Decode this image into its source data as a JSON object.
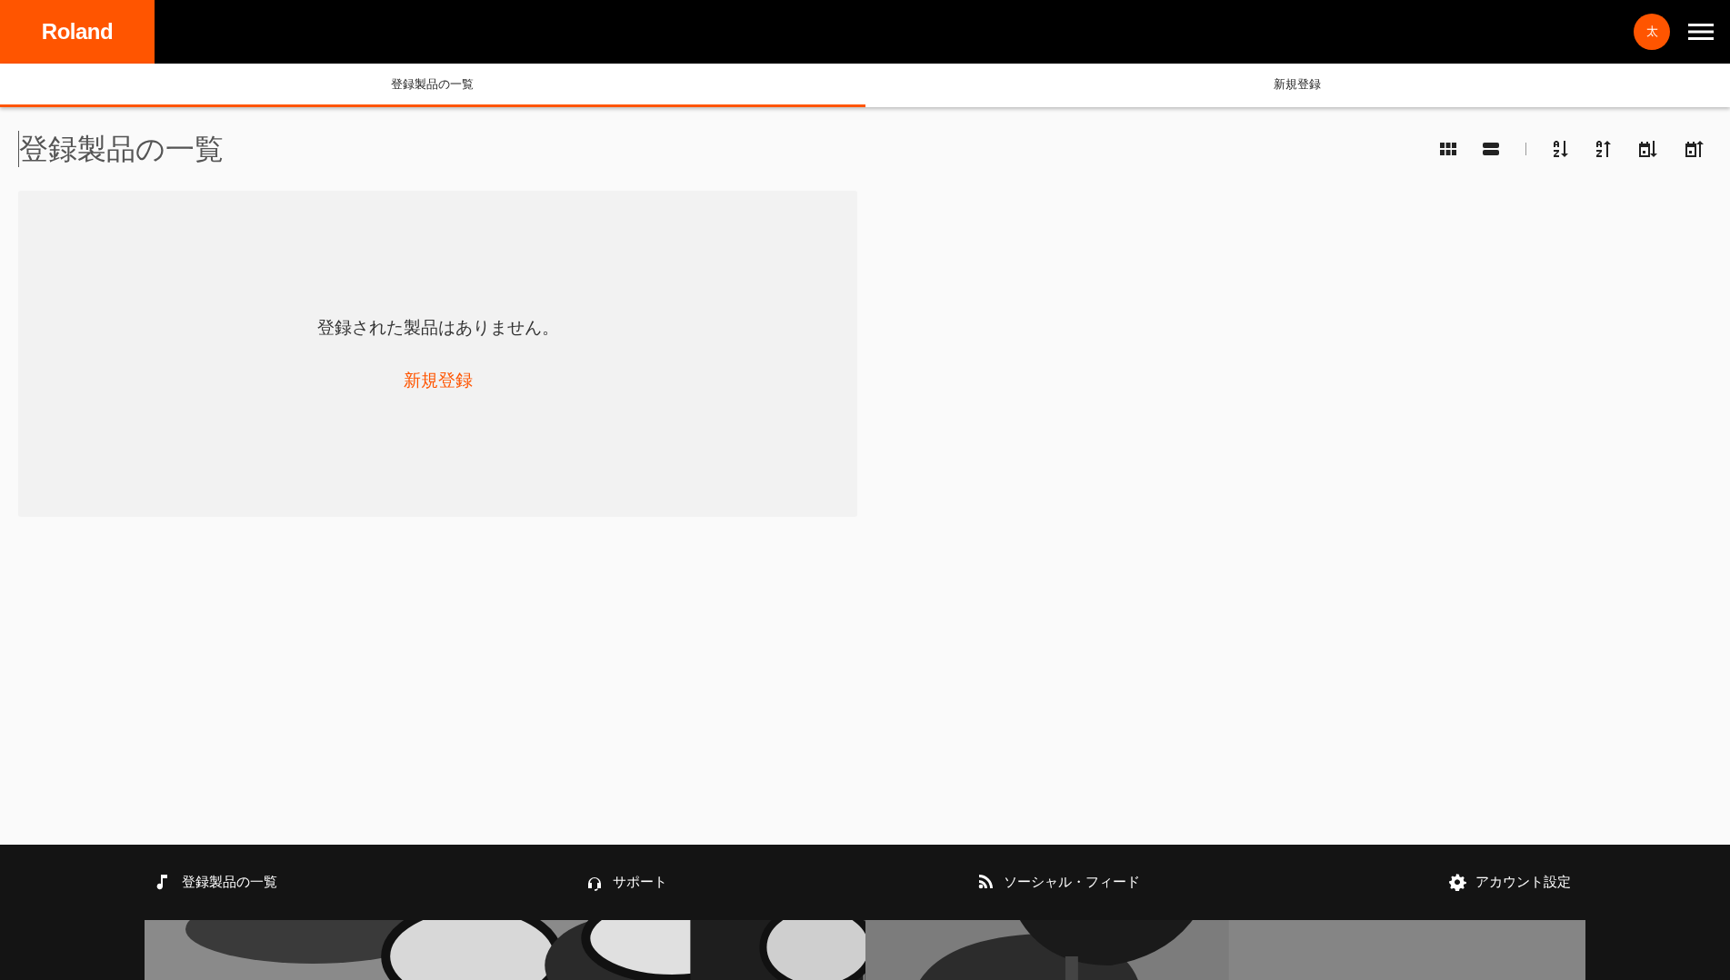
{
  "header": {
    "logo": "Roland",
    "avatar": "太"
  },
  "tabs": [
    {
      "label": "登録製品の一覧",
      "selected": true
    },
    {
      "label": "新規登録",
      "selected": false
    }
  ],
  "page_title": "登録製品の一覧",
  "empty_state": {
    "message": "登録された製品はありません。",
    "link": "新規登録"
  },
  "footer": {
    "links": [
      {
        "kind": "music",
        "label": "登録製品の一覧"
      },
      {
        "kind": "headset",
        "label": "サポート"
      },
      {
        "kind": "feed",
        "label": "ソーシャル・フィード"
      },
      {
        "kind": "settings",
        "label": "アカウント設定"
      }
    ]
  }
}
